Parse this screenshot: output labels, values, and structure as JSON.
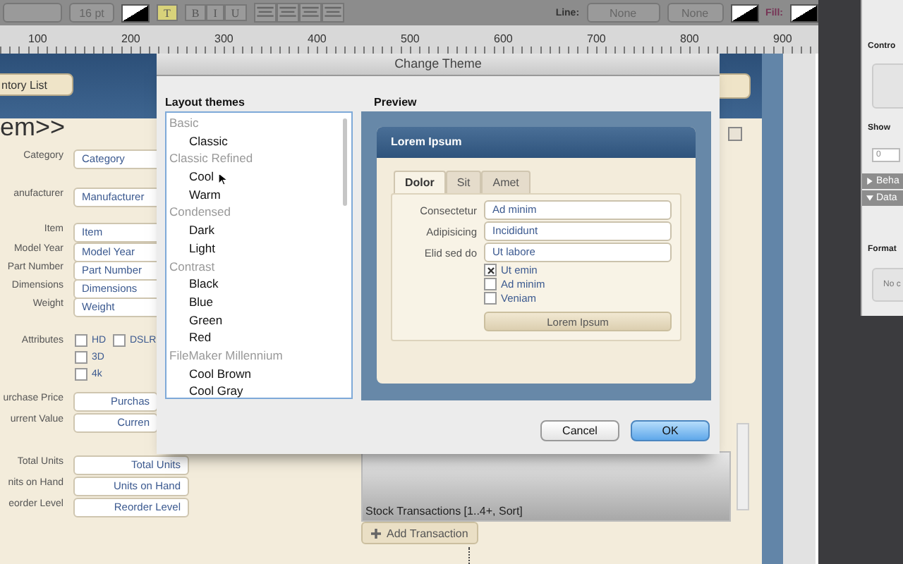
{
  "toolbar": {
    "font_size": "16 pt",
    "text_color_button": "T",
    "style_buttons": [
      "B",
      "I",
      "U"
    ],
    "line_label": "Line:",
    "line_options": [
      "None",
      "None"
    ],
    "fill_label": "Fill:"
  },
  "ruler": {
    "ticks": [
      "100",
      "200",
      "300",
      "400",
      "500",
      "600",
      "700",
      "800",
      "900"
    ]
  },
  "layout": {
    "nav_button": "ntory List",
    "title": "em>>",
    "fields": [
      {
        "label": "Category",
        "value": "Category"
      },
      {
        "label": "anufacturer",
        "value": "Manufacturer"
      },
      {
        "label": "Item",
        "value": "Item"
      },
      {
        "label": "Model Year",
        "value": "Model Year"
      },
      {
        "label": "Part Number",
        "value": "Part Number"
      },
      {
        "label": "Dimensions",
        "value": "Dimensions"
      },
      {
        "label": "Weight",
        "value": "Weight"
      },
      {
        "label": "urchase Price",
        "value": "Purchas"
      },
      {
        "label": "urrent Value",
        "value": "Curren"
      },
      {
        "label": "Total Units",
        "value": "Total Units"
      },
      {
        "label": "nits on Hand",
        "value": "Units on Hand"
      },
      {
        "label": "eorder Level",
        "value": "Reorder Level"
      }
    ],
    "attributes": {
      "label": "Attributes",
      "options": [
        {
          "label": "HD",
          "checked": false
        },
        {
          "label": "DSLR",
          "checked": false
        },
        {
          "label": "3D",
          "checked": false
        },
        {
          "label": "4k",
          "checked": false
        }
      ]
    },
    "portal_label": "Stock Transactions [1..4+, Sort]",
    "add_button": "Add Transaction"
  },
  "inspector": {
    "control_heading": "Contro",
    "show_heading": "Show",
    "show_value": "0",
    "sections": [
      {
        "label": "Beha",
        "expanded": false
      },
      {
        "label": "Data",
        "expanded": true
      }
    ],
    "format_heading": "Format",
    "format_value": "No c"
  },
  "dialog": {
    "title": "Change Theme",
    "themes_heading": "Layout themes",
    "themes": [
      {
        "label": "Basic",
        "children": [
          {
            "label": "Classic"
          }
        ]
      },
      {
        "label": "Classic Refined",
        "children": [
          {
            "label": "Cool"
          },
          {
            "label": "Warm"
          }
        ]
      },
      {
        "label": "Condensed",
        "children": [
          {
            "label": "Dark"
          },
          {
            "label": "Light"
          }
        ]
      },
      {
        "label": "Contrast",
        "children": [
          {
            "label": "Black"
          },
          {
            "label": "Blue"
          },
          {
            "label": "Green"
          },
          {
            "label": "Red"
          }
        ]
      },
      {
        "label": "FileMaker Millennium",
        "children": [
          {
            "label": "Cool Brown"
          },
          {
            "label": "Cool Gray"
          }
        ]
      }
    ],
    "preview_heading": "Preview",
    "preview": {
      "title": "Lorem Ipsum",
      "tabs": [
        {
          "label": "Dolor",
          "selected": true
        },
        {
          "label": "Sit",
          "selected": false
        },
        {
          "label": "Amet",
          "selected": false
        }
      ],
      "fields": [
        {
          "label": "Consectetur",
          "value": "Ad minim"
        },
        {
          "label": "Adipisicing",
          "value": "Incididunt"
        },
        {
          "label": "Elid sed do",
          "value": "Ut labore"
        }
      ],
      "checks": [
        {
          "label": "Ut emin",
          "checked": true
        },
        {
          "label": "Ad minim",
          "checked": false
        },
        {
          "label": "Veniam",
          "checked": false
        }
      ],
      "button": "Lorem Ipsum"
    },
    "buttons": {
      "cancel": "Cancel",
      "ok": "OK"
    }
  }
}
